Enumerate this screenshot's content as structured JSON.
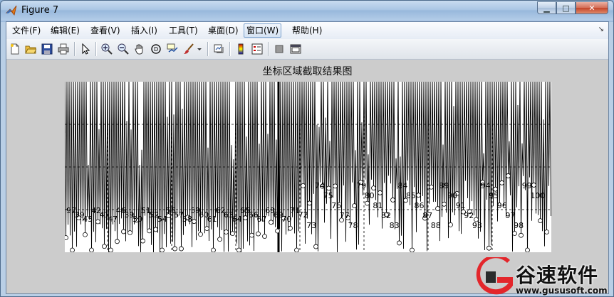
{
  "window": {
    "title": "Figure 7",
    "minimize_symbol": "▁",
    "maximize_symbol": "□",
    "close_symbol": "✕"
  },
  "menubar": {
    "items": [
      {
        "label": "文件(F)"
      },
      {
        "label": "编辑(E)"
      },
      {
        "label": "查看(V)"
      },
      {
        "label": "插入(I)"
      },
      {
        "label": "工具(T)"
      },
      {
        "label": "桌面(D)"
      },
      {
        "label": "窗口(W)",
        "active": true
      },
      {
        "label": "帮助(H)"
      }
    ],
    "overflow_symbol": "↘"
  },
  "toolbar": {
    "buttons": [
      "new-figure-icon",
      "open-file-icon",
      "save-icon",
      "print-icon",
      "edit-plot-arrow-icon",
      "zoom-in-icon",
      "zoom-out-icon",
      "pan-hand-icon",
      "rotate-3d-icon",
      "data-cursor-icon",
      "brush-icon",
      "brush-dropdown-icon",
      "link-plot-icon",
      "insert-colorbar-icon",
      "insert-legend-icon",
      "hide-plot-tools-icon",
      "show-plot-tools-icon"
    ]
  },
  "figure": {
    "title": "坐标区域截取结果图",
    "labels": [
      "97",
      "39",
      "45",
      "42",
      "41",
      "47",
      "46",
      "39",
      "50",
      "51",
      "52",
      "54",
      "55",
      "57",
      "58",
      "59",
      "60",
      "61",
      "62",
      "63",
      "64",
      "65",
      "66",
      "67",
      "68",
      "69",
      "70",
      "71",
      "72",
      "73",
      "74",
      "75",
      "76",
      "77",
      "78",
      "79",
      "80",
      "81",
      "82",
      "83",
      "84",
      "85",
      "86",
      "87",
      "88",
      "89",
      "90",
      "91",
      "92",
      "93",
      "94",
      "95",
      "96",
      "97",
      "98",
      "99",
      "100"
    ],
    "colors": {
      "background": "#ffffff",
      "line": "#000000",
      "frame": "#cccccc"
    }
  },
  "watermark": {
    "name": "谷速软件",
    "url": "www.gususoft.com",
    "colors": {
      "logo_red": "#e3262b",
      "logo_dark": "#2b2b2b"
    }
  }
}
